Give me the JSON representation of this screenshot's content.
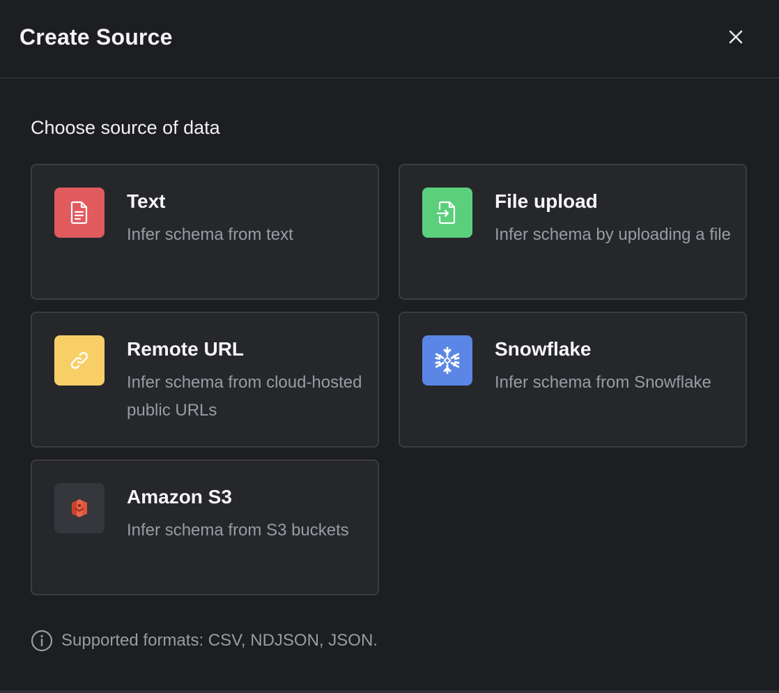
{
  "dialog": {
    "title": "Create Source",
    "close_icon": "close-icon"
  },
  "subtitle": "Choose source of data",
  "sources": [
    {
      "title": "Text",
      "description": "Infer schema from text",
      "icon": "document-icon",
      "icon_bg": "#e05a5e"
    },
    {
      "title": "File upload",
      "description": "Infer schema by uploading a file",
      "icon": "file-import-icon",
      "icon_bg": "#5ccf7c"
    },
    {
      "title": "Remote URL",
      "description": "Infer schema from cloud-hosted public URLs",
      "icon": "link-icon",
      "icon_bg": "#f8cf67"
    },
    {
      "title": "Snowflake",
      "description": "Infer schema from Snowflake",
      "icon": "snowflake-icon",
      "icon_bg": "#5b86e5"
    },
    {
      "title": "Amazon S3",
      "description": "Infer schema from S3 buckets",
      "icon": "amazon-s3-icon",
      "icon_bg": "#36373c"
    }
  ],
  "footer": {
    "note": "Supported formats: CSV, NDJSON, JSON.",
    "icon": "info-icon"
  }
}
